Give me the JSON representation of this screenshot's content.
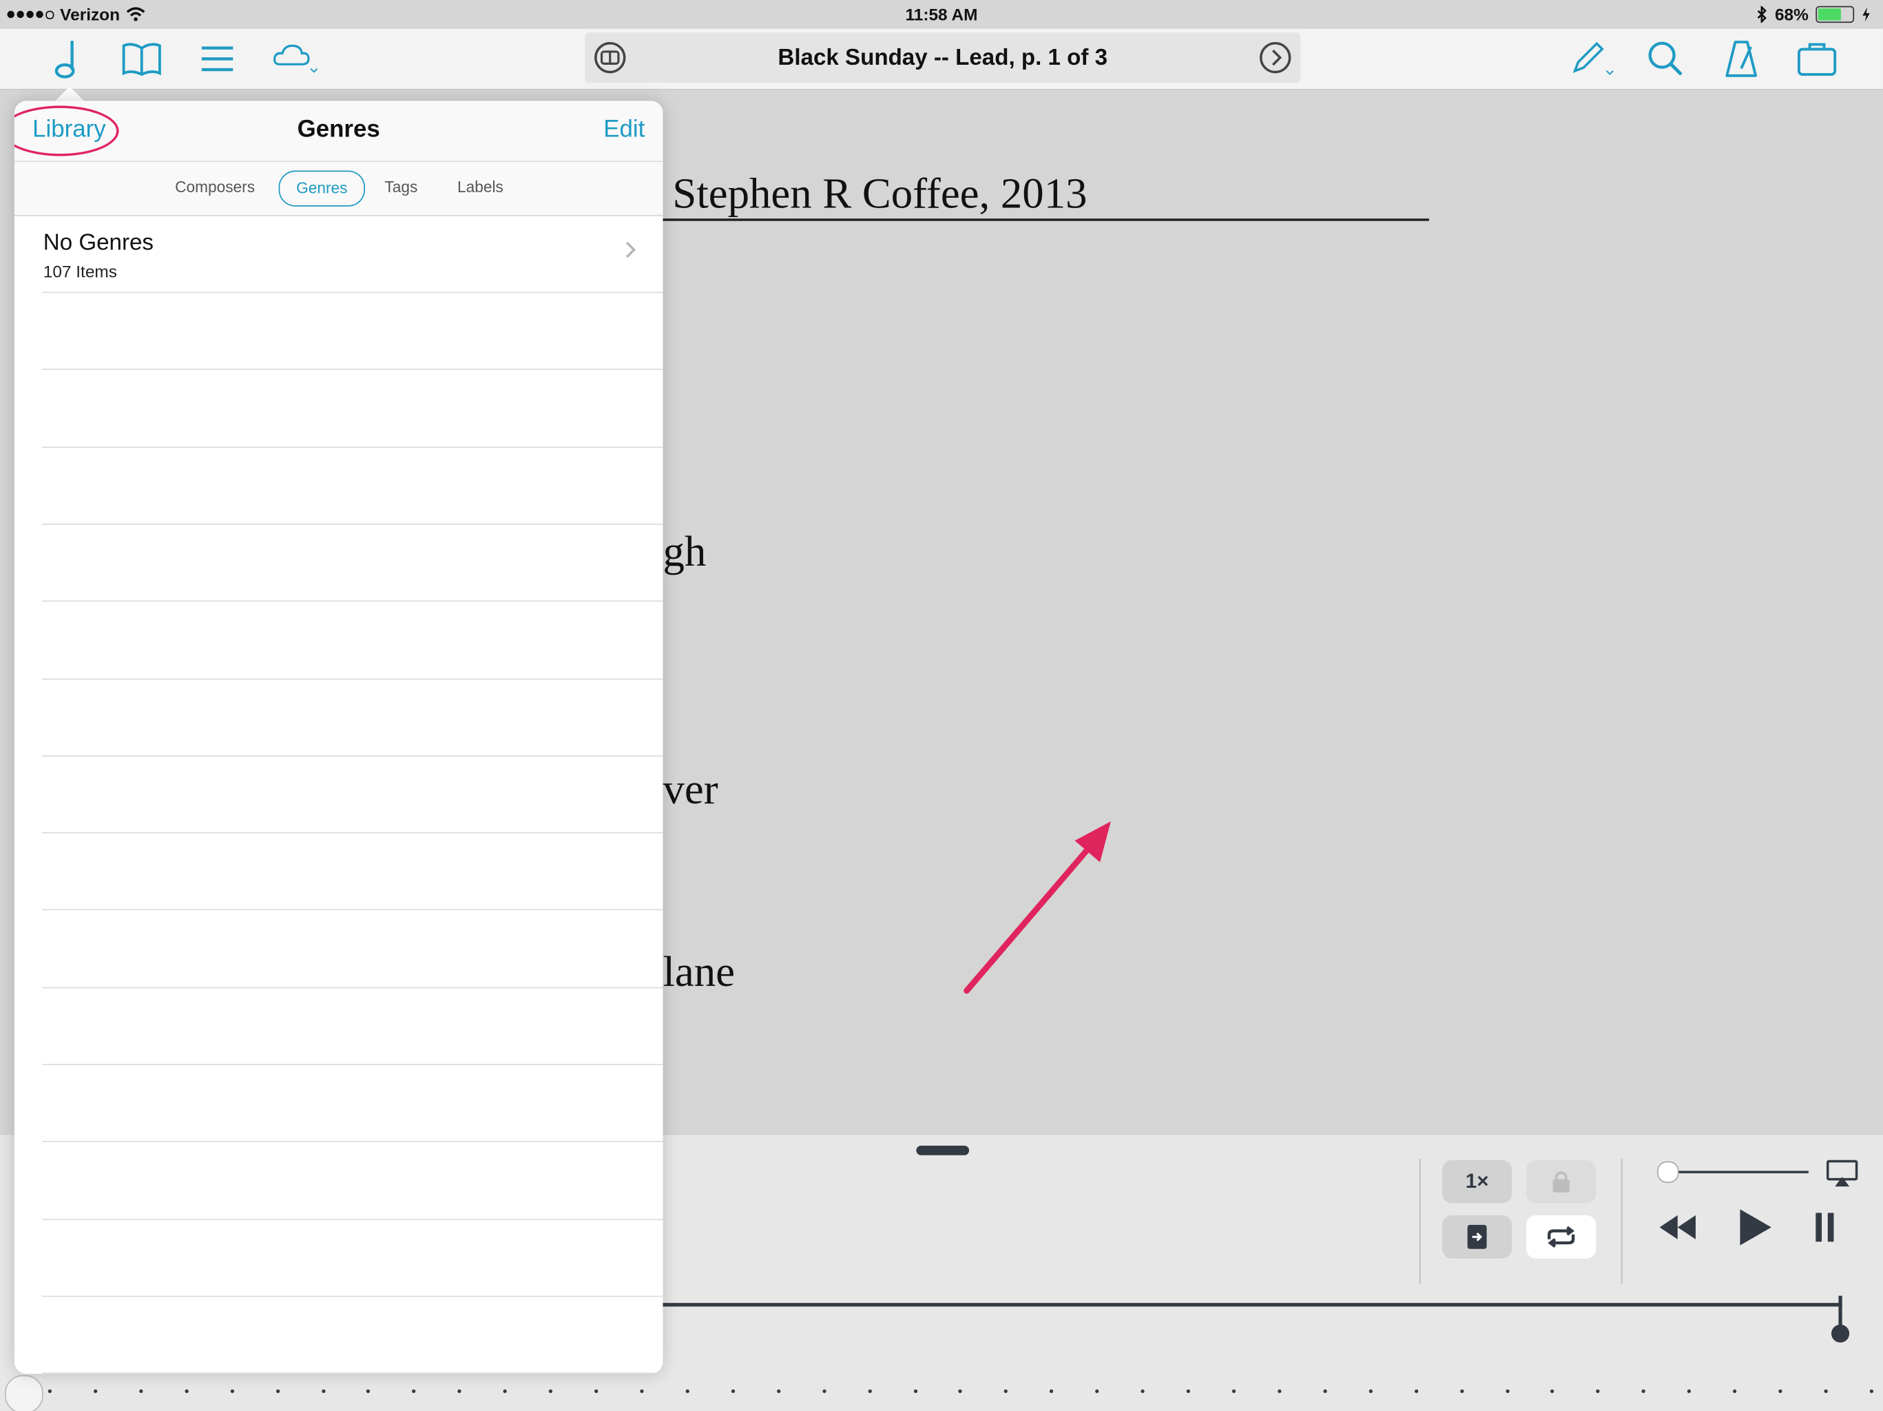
{
  "status_bar": {
    "carrier": "Verizon",
    "time": "11:58 AM",
    "battery": "68%",
    "battery_level": 0.68,
    "signal_bars": 4
  },
  "toolbar": {
    "title": "Black Sunday -- Lead, p. 1 of 3",
    "left_icons": [
      "music-note-icon",
      "book-icon",
      "list-icon",
      "cloud-icon"
    ],
    "right_icons": [
      "pencil-icon",
      "search-icon",
      "metronome-icon",
      "briefcase-icon"
    ],
    "accent_color": "#1e9bc4"
  },
  "score": {
    "composer_line": "Stephen R Coffee, 2013",
    "lyric_1": "gh",
    "lyric_2": "ver",
    "lyric_3": "lane"
  },
  "library": {
    "back_label": "Library",
    "title": "Genres",
    "edit_label": "Edit",
    "tabs": [
      "Composers",
      "Genres",
      "Tags",
      "Labels"
    ],
    "active_tab": "Genres",
    "items": [
      {
        "name": "No Genres",
        "count": "107 Items"
      }
    ]
  },
  "player": {
    "speed_label": "1×",
    "controls": [
      "rewind-icon",
      "play-icon",
      "pause-icon",
      "airplay-icon"
    ],
    "volume_level": 0.0
  },
  "annotation": {
    "highlight_color": "#e0245e"
  }
}
